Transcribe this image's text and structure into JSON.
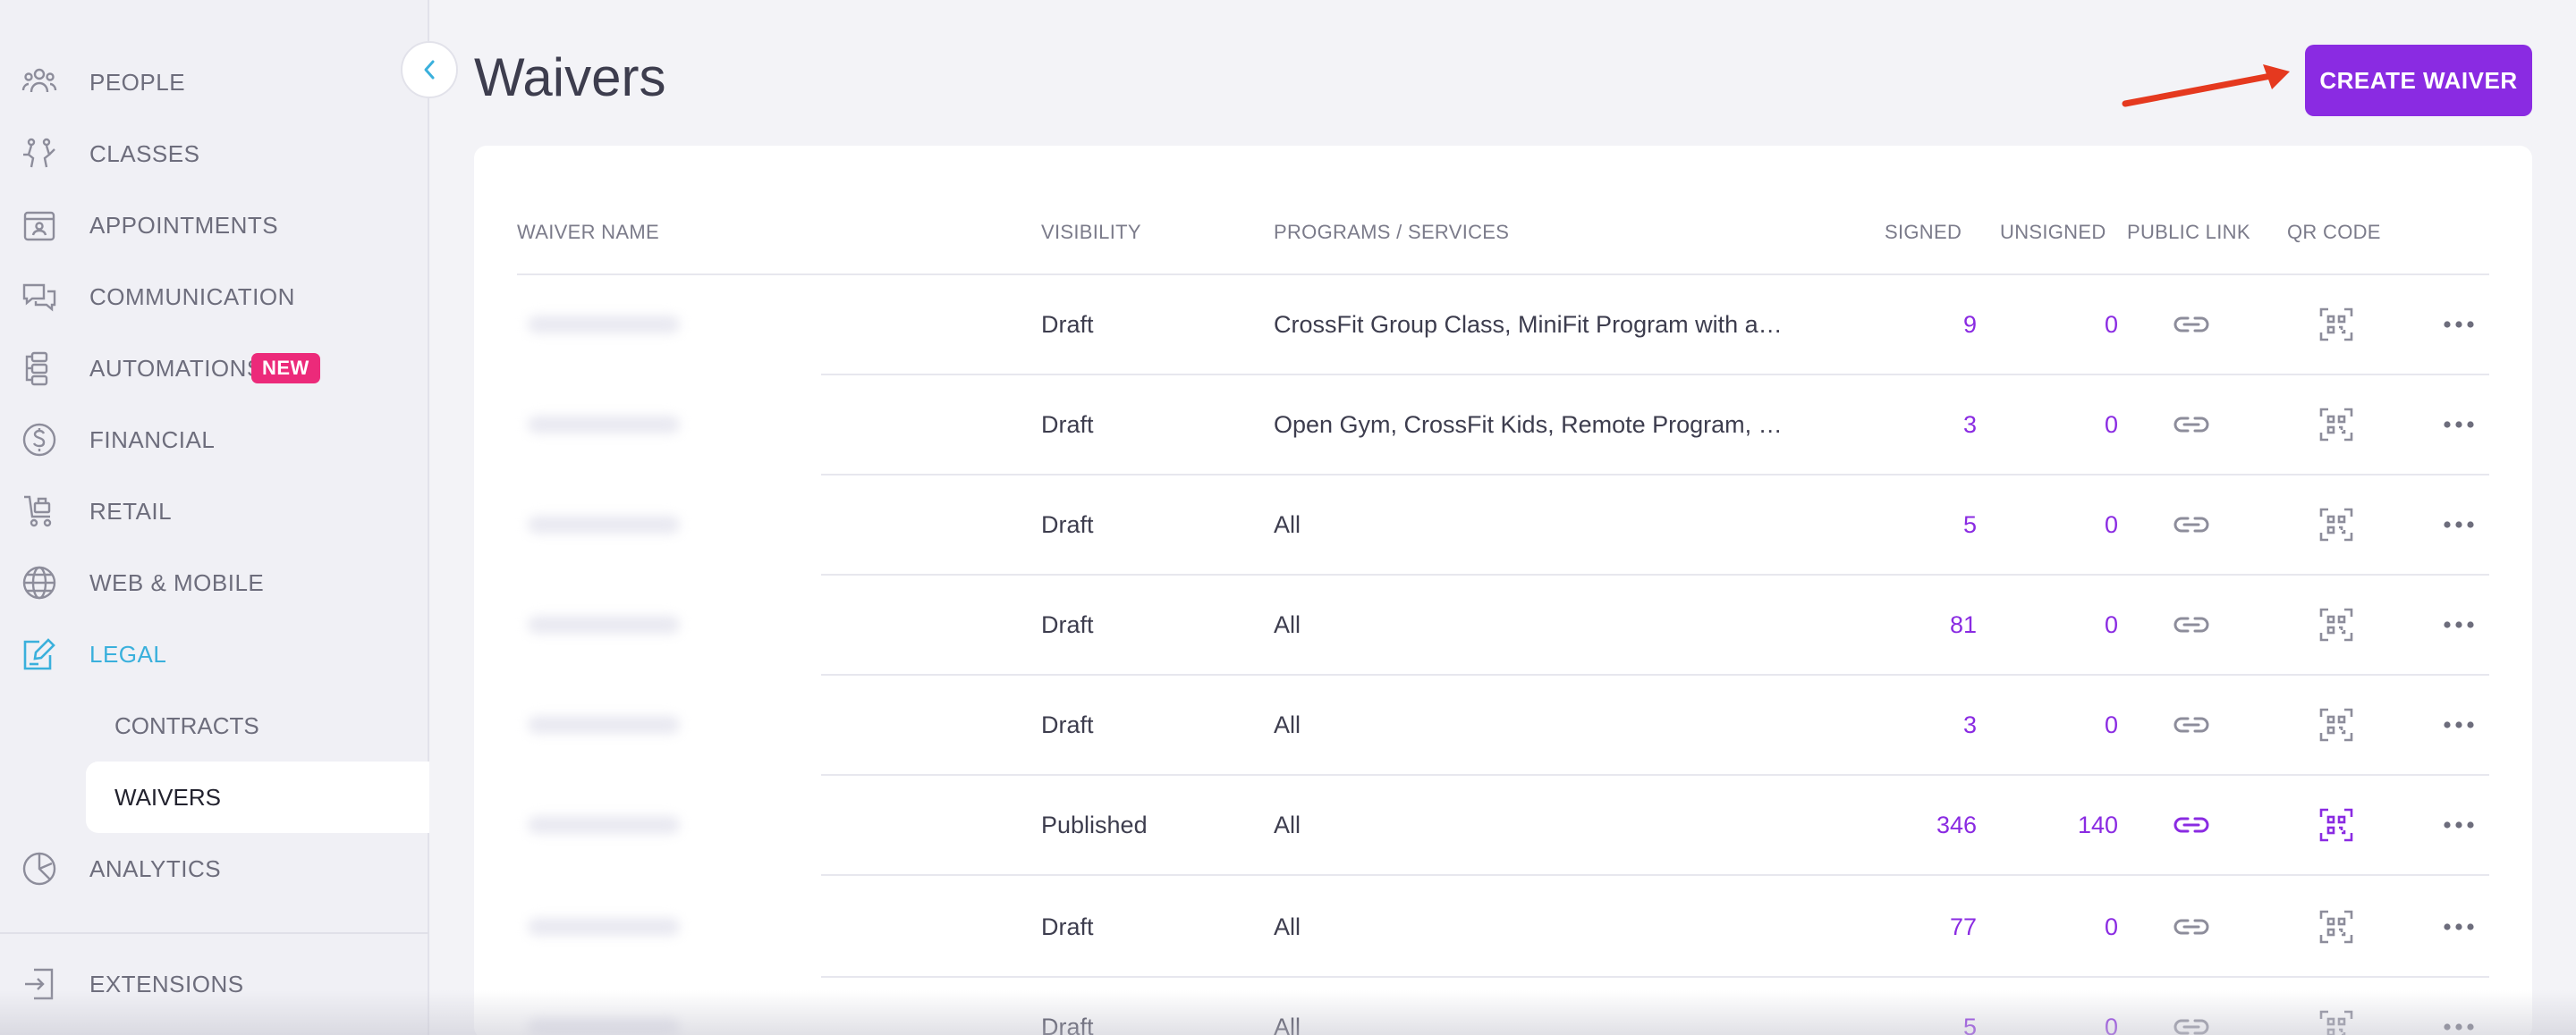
{
  "sidebar": {
    "items": [
      {
        "label": "PEOPLE",
        "icon": "people-icon"
      },
      {
        "label": "CLASSES",
        "icon": "classes-icon"
      },
      {
        "label": "APPOINTMENTS",
        "icon": "appointments-icon"
      },
      {
        "label": "COMMUNICATION",
        "icon": "communication-icon"
      },
      {
        "label": "AUTOMATIONS",
        "icon": "automations-icon",
        "badge": "NEW"
      },
      {
        "label": "FINANCIAL",
        "icon": "dollar-icon"
      },
      {
        "label": "RETAIL",
        "icon": "retail-icon"
      },
      {
        "label": "WEB & MOBILE",
        "icon": "globe-icon"
      },
      {
        "label": "LEGAL",
        "icon": "legal-icon",
        "active": true
      },
      {
        "label": "ANALYTICS",
        "icon": "analytics-icon"
      },
      {
        "label": "EXTENSIONS",
        "icon": "extensions-icon"
      }
    ],
    "legal_sub": [
      {
        "label": "CONTRACTS"
      },
      {
        "label": "WAIVERS",
        "selected": true
      }
    ]
  },
  "page": {
    "title": "Waivers",
    "create_button": "CREATE WAIVER"
  },
  "table": {
    "headers": {
      "name": "WAIVER NAME",
      "visibility": "VISIBILITY",
      "programs": "PROGRAMS / SERVICES",
      "signed": "SIGNED",
      "unsigned": "UNSIGNED",
      "public_link": "PUBLIC LINK",
      "qr_code": "QR CODE"
    },
    "rows": [
      {
        "visibility": "Draft",
        "programs": "CrossFit Group Class, MiniFit Program with an …",
        "signed": "9",
        "unsigned": "0",
        "published": false
      },
      {
        "visibility": "Draft",
        "programs": "Open Gym, CrossFit Kids, Remote Program, On…",
        "signed": "3",
        "unsigned": "0",
        "published": false
      },
      {
        "visibility": "Draft",
        "programs": "All",
        "signed": "5",
        "unsigned": "0",
        "published": false
      },
      {
        "visibility": "Draft",
        "programs": "All",
        "signed": "81",
        "unsigned": "0",
        "published": false
      },
      {
        "visibility": "Draft",
        "programs": "All",
        "signed": "3",
        "unsigned": "0",
        "published": false
      },
      {
        "visibility": "Published",
        "programs": "All",
        "signed": "346",
        "unsigned": "140",
        "published": true
      },
      {
        "visibility": "Draft",
        "programs": "All",
        "signed": "77",
        "unsigned": "0",
        "published": false
      },
      {
        "visibility": "Draft",
        "programs": "All",
        "signed": "5",
        "unsigned": "0",
        "published": false
      }
    ]
  },
  "colors": {
    "accent": "#8a2be2",
    "active_nav": "#3ab0dc",
    "badge": "#ec2a7a",
    "arrow": "#e5391f",
    "icon_muted": "#8d8d9b"
  }
}
